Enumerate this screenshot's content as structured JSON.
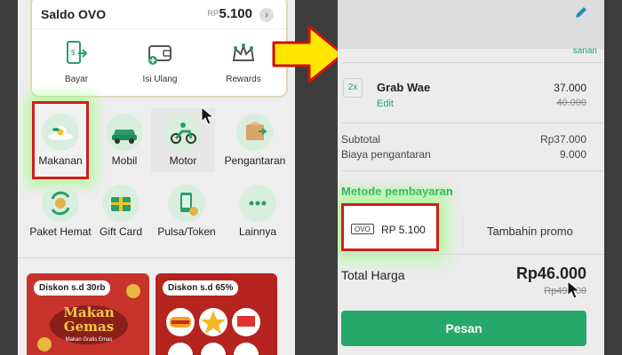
{
  "left": {
    "saldo_title": "Saldo OVO",
    "saldo_currency": "RP",
    "saldo_value": "5.100",
    "ovo_actions": [
      {
        "label": "Bayar",
        "icon": "phone-pay-icon"
      },
      {
        "label": "Isi Ulang",
        "icon": "wallet-topup-icon"
      },
      {
        "label": "Rewards",
        "icon": "crown-icon"
      }
    ],
    "services": [
      {
        "label": "Makanan",
        "icon": "food-icon"
      },
      {
        "label": "Mobil",
        "icon": "car-icon"
      },
      {
        "label": "Motor",
        "icon": "motorbike-icon"
      },
      {
        "label": "Pengantaran",
        "icon": "parcel-icon"
      },
      {
        "label": "Paket Hemat",
        "icon": "bundle-icon"
      },
      {
        "label": "Gift Card",
        "icon": "gift-card-icon"
      },
      {
        "label": "Pulsa/Token",
        "icon": "phone-credit-icon"
      },
      {
        "label": "Lainnya",
        "icon": "more-icon"
      }
    ],
    "promos": [
      {
        "badge": "Diskon s.d 30rb",
        "headline": "Makan Gemas",
        "sub": "Makan Gratis Emas"
      },
      {
        "badge": "Diskon s.d 65%"
      }
    ]
  },
  "right": {
    "simpan_text": "sanan",
    "item": {
      "qty": "2x",
      "name": "Grab Wae",
      "edit": "Edit",
      "price": "37.000",
      "price_old": "40.000"
    },
    "subtotal_label": "Subtotal",
    "subtotal_value": "Rp37.000",
    "delivery_label": "Biaya pengantaran",
    "delivery_value": "9.000",
    "payment_method_title": "Metode pembayaran",
    "payment_tag": "OVO",
    "payment_amount": "RP 5.100",
    "promo_label": "Tambahin promo",
    "total_label": "Total Harga",
    "total_value": "Rp46.000",
    "total_old": "Rp49.000",
    "order_button": "Pesan"
  },
  "colors": {
    "highlight": "#d11d1d",
    "arrow": "#ffe600",
    "brand_green": "#26a86a",
    "glow": "#96ff78"
  }
}
